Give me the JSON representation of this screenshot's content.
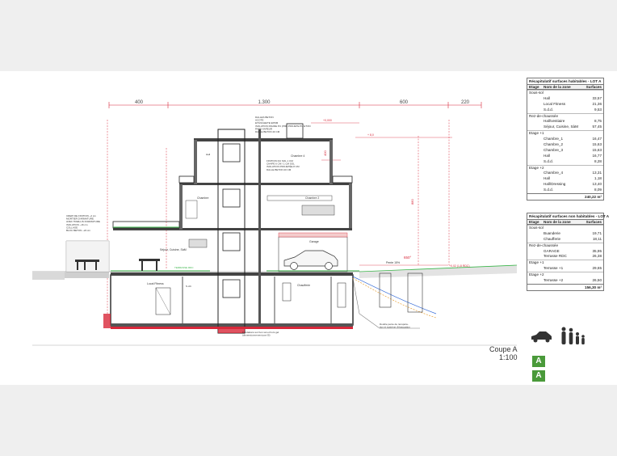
{
  "dimensions": {
    "top": [
      "400",
      "1.300",
      "600",
      "220"
    ]
  },
  "levels": {
    "top": "+0,000",
    "roof": "+ 8,0",
    "ground_right": "+0,02 (1,8 RDC)",
    "ramp": "Pente 15%",
    "ramp_grade": "650°",
    "h_right": "880",
    "h_left": "400"
  },
  "rooms": {
    "chambre4": "Chambre 4",
    "chambre2": "Chambre 2",
    "chambre": "Chambre",
    "sejour": "Séjour, Cuisine, SàM",
    "garage": "Garage",
    "local_fitness": "Local Fitness",
    "chaufferie": "Chaufferie",
    "hall": "Hall",
    "sdb": "S.d.b"
  },
  "notes": {
    "dalles": "DALLES BETON\nACOTE\nETANCHEITE EPDM\nISOLATION RIGIDE PU (PIR) PROJETE PU ETON\nPARE-VAPEUR\nDALLE BETON 20 CM",
    "chape": "FINITION DU SOL 1 CM\nCHAPE 6 CM / 1 CM SOL\nISOLATION PROJETÉE 8 CM\nDALLE BETON 20 CM",
    "fondations": "Fondations sur bon sol et hors gel\n(dimensionnement par IS)",
    "puits": "Double pente de récupéra-\ntion et système d'évacuation",
    "left_wall": "CREPI DE FINITION ~2 cm\nMORTIER D'ARMATURE\nAVEC TREILLIS D'ARMATURE\nISOLATION ~16 cm\nCOLLAGE\nBLOC BETON ~24 cm",
    "terrasse": "TERRASSE RDC"
  },
  "table_habitable": {
    "title": "Récapitulatif surfaces habitables - LOT A",
    "headers": [
      "Etage",
      "Nom de la zone",
      "Surfaces"
    ],
    "groups": [
      {
        "name": "Sous-sol",
        "items": [
          [
            "Hall",
            "33,57"
          ],
          [
            "Local Fitness",
            "21,36"
          ],
          [
            "S.d.d.",
            "9,53"
          ]
        ]
      },
      {
        "name": "Rez-de-chaussée",
        "items": [
          [
            "Hall/vestiaire",
            "8,75"
          ],
          [
            "Séjour, Cuisine, SàM",
            "57,45"
          ]
        ]
      },
      {
        "name": "Etage +1",
        "items": [
          [
            "Chambre_1",
            "16,47"
          ],
          [
            "Chambre_2",
            "15,63"
          ],
          [
            "Chambre_3",
            "15,63"
          ],
          [
            "Hall",
            "16,77"
          ],
          [
            "S.d.d.",
            "8,28"
          ]
        ]
      },
      {
        "name": "Etage +2",
        "items": [
          [
            "Chambre_4",
            "13,31"
          ],
          [
            "Hall",
            "1,18"
          ],
          [
            "Hall/Dressing",
            "13,40"
          ],
          [
            "S.d.d.",
            "8,09"
          ]
        ]
      }
    ],
    "total": "240,22 m²"
  },
  "table_non_habitable": {
    "title": "Récapitulatif surfaces non habitables - LOT A",
    "headers": [
      "Etage",
      "Nom de la zone",
      "Surfaces"
    ],
    "groups": [
      {
        "name": "Sous-sol",
        "items": [
          [
            "Buanderie",
            "19,71"
          ],
          [
            "Chaufferie",
            "18,11"
          ]
        ]
      },
      {
        "name": "Rez-de-chaussée",
        "items": [
          [
            "GARAGE",
            "35,95"
          ],
          [
            "Terrasse RDC",
            "26,38"
          ]
        ]
      },
      {
        "name": "Etage +1",
        "items": [
          [
            "Terrasse +1",
            "29,65"
          ]
        ]
      },
      {
        "name": "Etage +2",
        "items": [
          [
            "Terrasse +2",
            "26,50"
          ]
        ]
      }
    ],
    "total": "156,30 m²"
  },
  "drawing_title": "Coupe A",
  "scale": "1:100",
  "energy_class": [
    "A",
    "A"
  ],
  "colors": {
    "dimension": "#d8283a",
    "section": "#222222",
    "ground": "#7a7a7a",
    "insulation_green": "#3bb54a",
    "drain_blue": "#3a6fd8",
    "drain_orange": "#e8a23a",
    "energy_green": "#4a9a3a"
  }
}
